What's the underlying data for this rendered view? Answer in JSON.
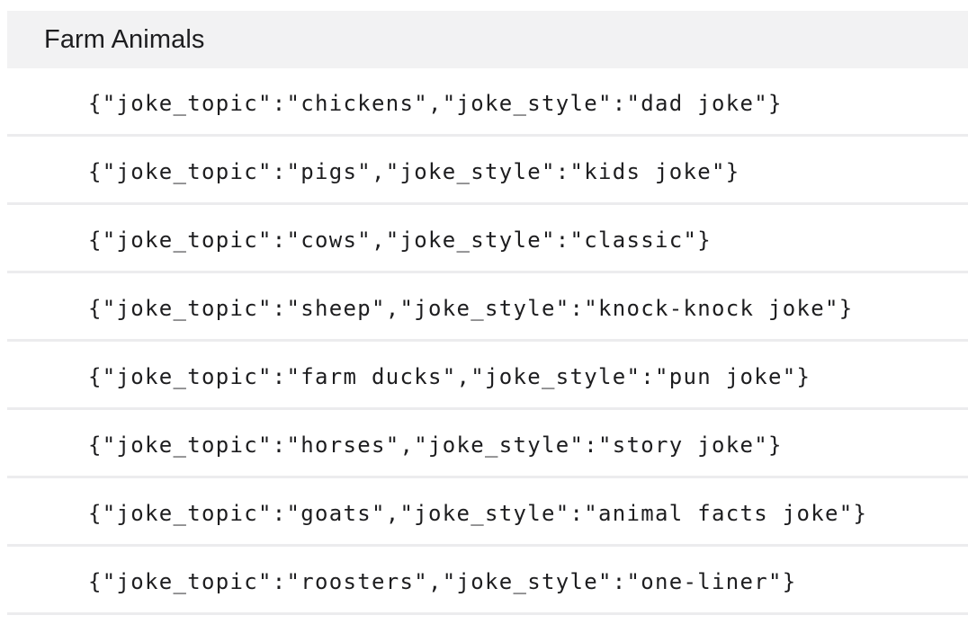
{
  "group": {
    "title": "Farm Animals",
    "rows": [
      "{\"joke_topic\":\"chickens\",\"joke_style\":\"dad joke\"}",
      "{\"joke_topic\":\"pigs\",\"joke_style\":\"kids joke\"}",
      "{\"joke_topic\":\"cows\",\"joke_style\":\"classic\"}",
      "{\"joke_topic\":\"sheep\",\"joke_style\":\"knock-knock joke\"}",
      "{\"joke_topic\":\"farm ducks\",\"joke_style\":\"pun joke\"}",
      "{\"joke_topic\":\"horses\",\"joke_style\":\"story joke\"}",
      "{\"joke_topic\":\"goats\",\"joke_style\":\"animal facts joke\"}",
      "{\"joke_topic\":\"roosters\",\"joke_style\":\"one-liner\"}"
    ]
  }
}
